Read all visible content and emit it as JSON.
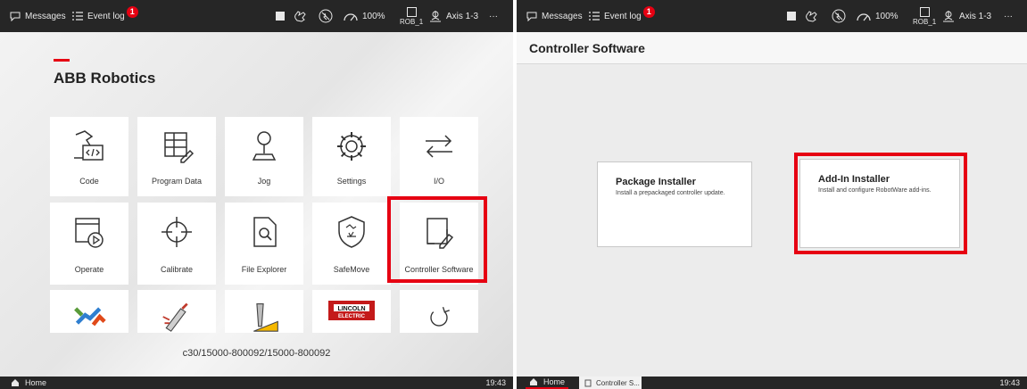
{
  "left": {
    "topbar": {
      "messages": "Messages",
      "event_log": "Event log",
      "event_count": "1",
      "speed": "100%",
      "rob": "ROB_1",
      "axis": "Axis 1-3",
      "more": "···"
    },
    "brand": "ABB Robotics",
    "tiles": [
      {
        "label": "Code",
        "icon": "code-icon"
      },
      {
        "label": "Program Data",
        "icon": "program-data-icon"
      },
      {
        "label": "Jog",
        "icon": "joystick-icon"
      },
      {
        "label": "Settings",
        "icon": "gear-icon"
      },
      {
        "label": "I/O",
        "icon": "io-arrows-icon"
      },
      {
        "label": "Operate",
        "icon": "operate-icon"
      },
      {
        "label": "Calibrate",
        "icon": "crosshair-icon"
      },
      {
        "label": "File Explorer",
        "icon": "file-search-icon"
      },
      {
        "label": "SafeMove",
        "icon": "safemove-shield-icon"
      },
      {
        "label": "Controller Software",
        "icon": "controller-software-icon"
      }
    ],
    "lincoln_text": "LINCOLN\nELECTRIC",
    "controller_path": "c30/15000-800092/15000-800092",
    "bottombar": {
      "home": "Home",
      "time": "19:43"
    }
  },
  "right": {
    "topbar": {
      "messages": "Messages",
      "event_log": "Event log",
      "event_count": "1",
      "speed": "100%",
      "rob": "ROB_1",
      "axis": "Axis 1-3",
      "more": "···"
    },
    "page_title": "Controller Software",
    "cards": [
      {
        "title": "Package Installer",
        "desc": "Install a prepackaged controller update."
      },
      {
        "title": "Add-In Installer",
        "desc": "Install and configure RobotWare add-ins."
      }
    ],
    "bottombar": {
      "home": "Home",
      "tab": "Controller S...",
      "time": "19:43"
    }
  },
  "colors": {
    "accent": "#e60012",
    "bar": "#262626"
  }
}
